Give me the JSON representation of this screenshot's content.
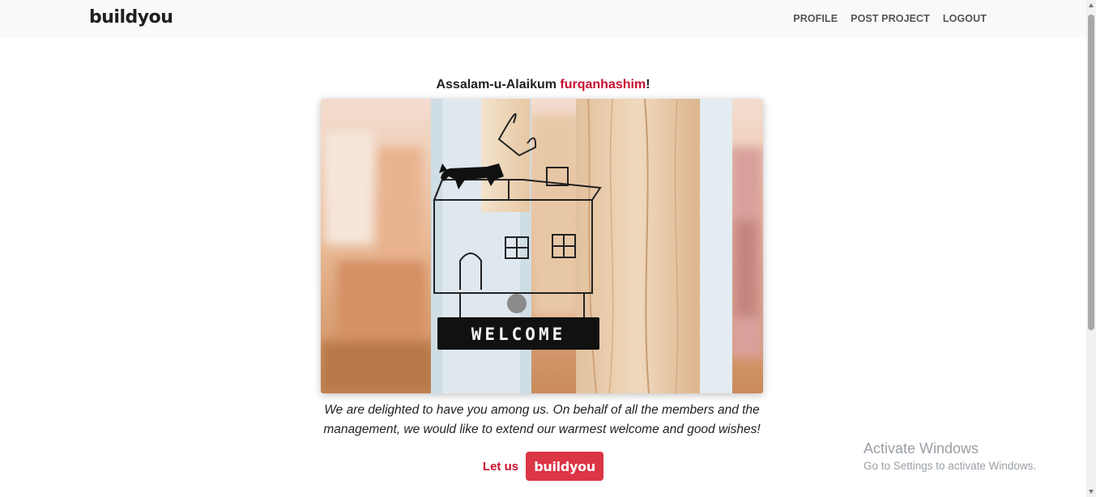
{
  "navbar": {
    "brand_text": "buildyou",
    "links": [
      {
        "label": "PROFILE"
      },
      {
        "label": "POST PROJECT"
      },
      {
        "label": "LOGOUT"
      }
    ]
  },
  "greeting": {
    "prefix": "Assalam-u-Alaikum ",
    "username": "furqanhashim",
    "suffix": "!"
  },
  "hero": {
    "sign_text": "WELCOME"
  },
  "welcome_message": "We are delighted to have you among us. On behalf of all the members and the management, we would like to extend our warmest welcome and good wishes!",
  "cta": {
    "label": "Let us",
    "button_text": "buildyou"
  },
  "watermark": {
    "title": "Activate Windows",
    "subtitle": "Go to Settings to activate Windows."
  },
  "colors": {
    "accent": "#dc3545",
    "username": "#c8102e",
    "navbar_bg": "#f8f9fa"
  }
}
